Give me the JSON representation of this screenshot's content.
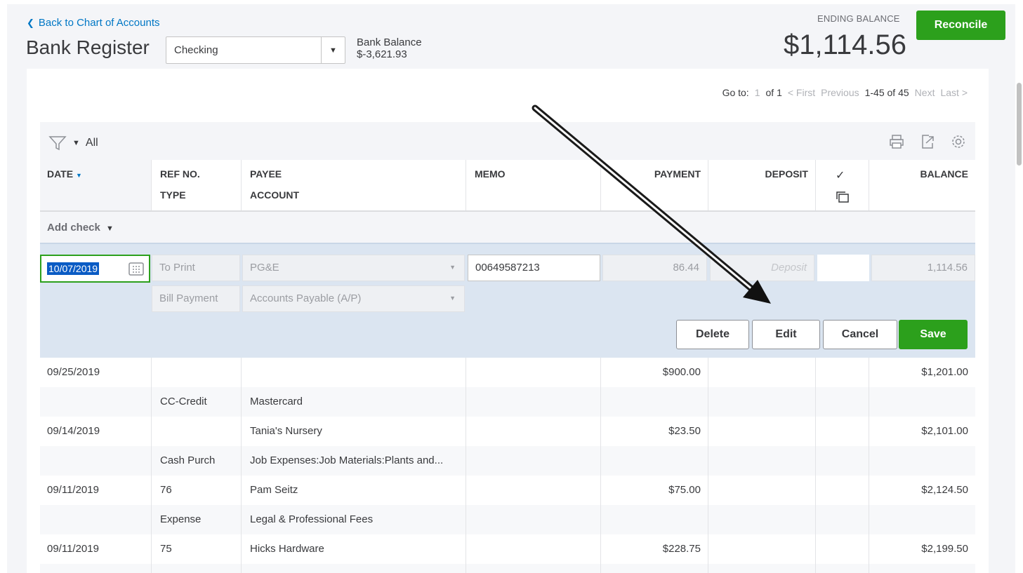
{
  "nav": {
    "back_label": "Back to Chart of Accounts"
  },
  "page": {
    "title": "Bank Register"
  },
  "account_select": {
    "value": "Checking"
  },
  "bank_balance": {
    "label": "Bank Balance",
    "value": "$-3,621.93"
  },
  "ending_balance": {
    "label": "ENDING BALANCE",
    "value": "$1,114.56"
  },
  "reconcile_label": "Reconcile",
  "pager": {
    "goto_label": "Go to:",
    "page": "1",
    "of_pages": "of 1",
    "first": "< First",
    "previous": "Previous",
    "range": "1-45 of 45",
    "next": "Next",
    "last": "Last >"
  },
  "filter": {
    "label": "All"
  },
  "columns": {
    "date": "DATE",
    "ref": "REF NO.",
    "type": "TYPE",
    "payee": "PAYEE",
    "account": "ACCOUNT",
    "memo": "MEMO",
    "payment": "PAYMENT",
    "deposit": "DEPOSIT",
    "check": "✓",
    "balance": "BALANCE"
  },
  "add_check_label": "Add check",
  "edit_row": {
    "date": "10/07/2019",
    "ref": "To Print",
    "payee": "PG&E",
    "memo": "00649587213",
    "payment": "86.44",
    "deposit_placeholder": "Deposit",
    "balance": "1,114.56",
    "type": "Bill Payment",
    "account": "Accounts Payable (A/P)",
    "buttons": {
      "delete": "Delete",
      "edit": "Edit",
      "cancel": "Cancel",
      "save": "Save"
    }
  },
  "transactions": [
    {
      "date": "09/25/2019",
      "ref": "",
      "payee": "",
      "payment": "$900.00",
      "balance": "$1,201.00",
      "type": "CC-Credit",
      "account": "Mastercard"
    },
    {
      "date": "09/14/2019",
      "ref": "",
      "payee": "Tania's Nursery",
      "payment": "$23.50",
      "balance": "$2,101.00",
      "type": "Cash Purch",
      "account": "Job Expenses:Job Materials:Plants and..."
    },
    {
      "date": "09/11/2019",
      "ref": "76",
      "payee": "Pam Seitz",
      "payment": "$75.00",
      "balance": "$2,124.50",
      "type": "Expense",
      "account": "Legal & Professional Fees"
    },
    {
      "date": "09/11/2019",
      "ref": "75",
      "payee": "Hicks Hardware",
      "payment": "$228.75",
      "balance": "$2,199.50",
      "type": "",
      "account": ""
    }
  ],
  "colors": {
    "brand_green": "#2ca01c",
    "link_blue": "#0077c5",
    "edit_row_bg": "#dbe5f1"
  }
}
